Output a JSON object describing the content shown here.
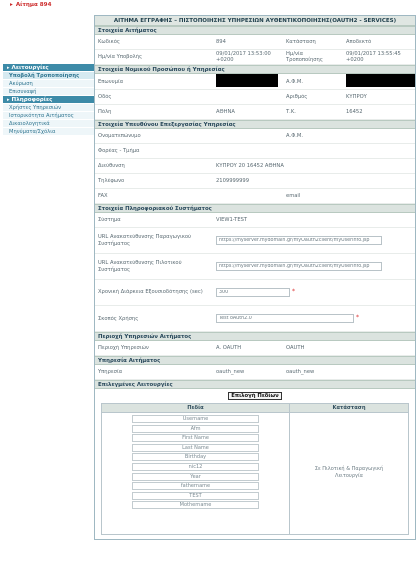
{
  "breadcrumb": "Αίτημα 894",
  "sidebar": {
    "sections": [
      {
        "title": "Λειτουργίες",
        "items": [
          "Υποβολή Τροποποίησης",
          "Ακύρωση",
          "Επισυναφή"
        ]
      },
      {
        "title": "Πληροφορίες",
        "items": [
          "Χρήστες Υπηρεσιών",
          "Ιστορικότητα Αιτήματος",
          "Δικαιολογητικά",
          "Μηνύματα/Σχόλια"
        ]
      }
    ]
  },
  "form": {
    "title": "ΑΙΤΗΜΑ ΕΓΓΡΑΦΗΣ – ΠΙΣΤΟΠΟΙΗΣΗΣ ΥΠΗΡΕΣΙΩΝ ΑΥΘΕΝΤΙΚΟΠΟΙΗΣΗΣ(OAUTH2 - SERVICES)",
    "request": {
      "header": "Στοιχεία Αιτήματος",
      "code_label": "Κωδικός",
      "code": "894",
      "status_label": "Κατάσταση",
      "status": "Αποδεκτό",
      "submit_label": "Ημ/νία Υποβολής",
      "submit_date": "09/01/2017 13:53:00 +0200",
      "update_label": "Ημ/νία Τροποποίησης",
      "update_date": "09/01/2017 13:55:45 +0200"
    },
    "entity": {
      "header": "Στοιχεία Νομικού Προσώπου ή Υπηρεσίας",
      "name_label": "Επωνυμία",
      "afm_label": "Α.Φ.Μ.",
      "street_label": "Οδός",
      "number_label": "Αριθμός",
      "number": "ΚΥΠΡΟΥ",
      "city_label": "Πόλη",
      "city": "ΑΘΗΝΑ",
      "tk_label": "Τ.Κ.",
      "tk": "16452"
    },
    "officer": {
      "header": "Στοιχεία Υπευθύνου Επεξεργασίας Υπηρεσίας",
      "fullname_label": "Ονοματεπώνυμο",
      "afm_label": "Α.Φ.Μ.",
      "dept_label": "Φορέας - Τμήμα",
      "address_label": "Διεύθυνση",
      "address": "ΚΥΠΡΟΥ 20 16452 ΑΘΗΝΑ",
      "phone_label": "Τηλέφωνο",
      "phone": "2109999999",
      "fax_label": "FAX",
      "email_label": "email"
    },
    "system": {
      "header": "Στοιχεία Πληροφοριακού Συστήματος",
      "system_label": "Σύστημα",
      "system": "VIEW1-TEST",
      "redirect_prod_label": "URL Ανακατεύθυνσης Παραγωγικού Συστήματος",
      "redirect_prod": "https://myserver.mydomain.gr/myOauth2client/myUserInfo.jsp",
      "redirect_pilot_label": "URL Ανακατεύθυνσης Πιλοτικού Συστήματος",
      "redirect_pilot": "https://myserver.mydomain.gr/myOauth2client/myUserInfo.jsp",
      "duration_label": "Χρονική Διάρκεια Εξουσιοδότησης (sec)",
      "duration": "300",
      "purpose_label": "Σκοπός Χρήσης",
      "purpose": "Test oAuth2.0"
    },
    "area": {
      "header": "Περιοχή Υπηρεσιών Αιτήματος",
      "label": "Περιοχή Υπηρεσιών",
      "code": "A. OAUTH",
      "name": "OAUTH"
    },
    "service": {
      "header": "Υπηρεσία Αιτήματος",
      "label": "Υπηρεσία",
      "code": "oauth_new",
      "name": "oauth_new"
    },
    "functions": {
      "header": "Επιλεγμένες Λειτουργίες",
      "button": "Επιλογή Πεδίων",
      "fields_header": "Πεδία",
      "status_header": "Κατάσταση",
      "fields": [
        "Username",
        "Afm",
        "First Name",
        "Last Name",
        "Birthday",
        "nic12",
        "Year",
        "fathername",
        "TEST",
        "Mothername"
      ],
      "status_value": "Σε Πιλοτική & Παραγωγική Λειτουργία"
    }
  }
}
